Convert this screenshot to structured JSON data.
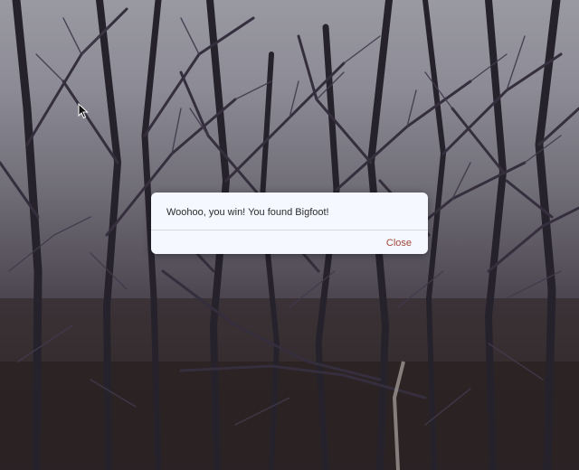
{
  "dialog": {
    "message": "Woohoo, you win! You found Bigfoot!",
    "close_label": "Close"
  },
  "background": {
    "icon": "forest-photo"
  },
  "cursor": {
    "icon": "arrow-cursor-icon"
  },
  "colors": {
    "dialog_bg": "#f5f8ff",
    "close_text": "#a2473a",
    "message_text": "#2b2b2b"
  }
}
